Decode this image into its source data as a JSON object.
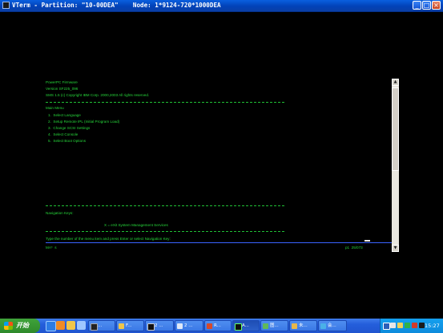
{
  "window": {
    "title": "VTerm - Partition: \"10-00DEA\"    Node: 1*9124-720*1000DEA",
    "minimize_symbol": "_",
    "maximize_symbol": "□",
    "close_symbol": "×",
    "accent_color": "#0242b8"
  },
  "terminal": {
    "text_color": "#26d63a",
    "header": {
      "line1": "PowerPC Firmware",
      "line2": "Version SF225_096",
      "line3": "SMS 1.5 (c) Copyright IBM Corp. 2000,2003 All rights reserved."
    },
    "menu_title": "Main Menu",
    "menu_items": [
      "1.  Select Language",
      "2.  Setup Remote IPL (Initial Program Load)",
      "3.  Change SCSI Settings",
      "4.  Select Console",
      "5.  Select Boot Options"
    ],
    "navigation_title": "Navigation Keys:",
    "navigation_hint": "X = eXit System Management Services",
    "prompt": "Type the number of the menu item and press Enter or select Navigation Key:",
    "status_left": "MA*  s",
    "status_right": "p1  25/073"
  },
  "scrollbar": {
    "up_symbol": "▲",
    "down_symbol": "▼"
  },
  "taskbar": {
    "start_label": "开始",
    "quick_launch": [
      "ie-icon",
      "media-icon",
      "folder-icon",
      "desktop-icon"
    ],
    "tasks": [
      {
        "label": "...",
        "icon": "terminal-icon"
      },
      {
        "label": "F...",
        "icon": "folder-icon"
      },
      {
        "label": "2 ...",
        "icon": "cmd-icon"
      },
      {
        "label": "2 ...",
        "icon": "window-icon"
      },
      {
        "label": "R...",
        "icon": "app-icon"
      },
      {
        "label": "A...",
        "icon": "vterm-icon"
      },
      {
        "label": "图...",
        "icon": "image-icon"
      },
      {
        "label": "未...",
        "icon": "paint-icon"
      },
      {
        "label": "会...",
        "icon": "chat-icon"
      }
    ],
    "tray_icons": [
      "lang-icon",
      "help-icon",
      "volume-icon",
      "network-icon",
      "antivirus-icon",
      "im-icon",
      "update-icon"
    ],
    "clock": "15:27"
  }
}
